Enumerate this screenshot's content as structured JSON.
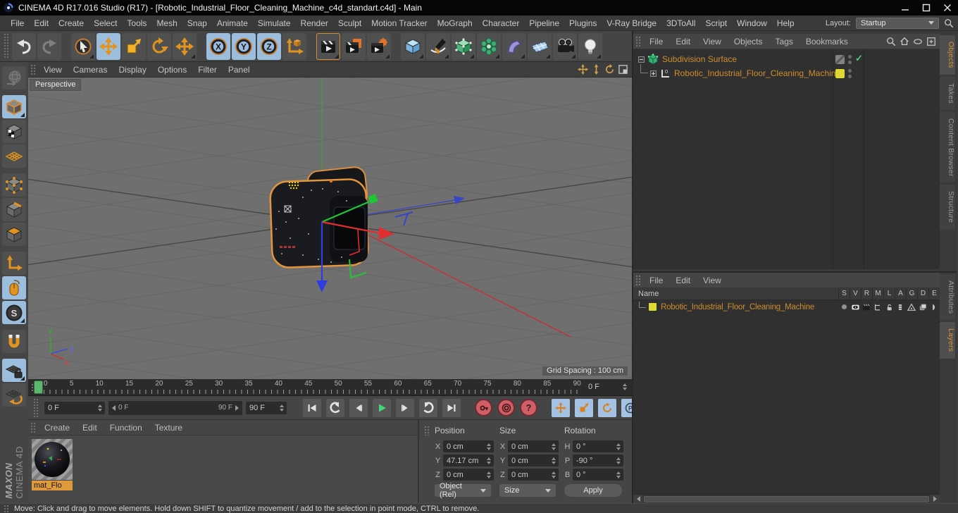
{
  "window": {
    "title": "CINEMA 4D R17.016 Studio (R17) - [Robotic_Industrial_Floor_Cleaning_Machine_c4d_standart.c4d] - Main"
  },
  "menu_bar": {
    "items": [
      "File",
      "Edit",
      "Create",
      "Select",
      "Tools",
      "Mesh",
      "Snap",
      "Animate",
      "Simulate",
      "Render",
      "Sculpt",
      "Motion Tracker",
      "MoGraph",
      "Character",
      "Pipeline",
      "Plugins",
      "V-Ray Bridge",
      "3DToAll",
      "Script",
      "Window",
      "Help"
    ],
    "layout_label": "Layout:",
    "layout_value": "Startup"
  },
  "toolbar": {
    "tools": [
      "undo",
      "redo",
      "live-selection",
      "move",
      "scale",
      "rotate",
      "last-tool-move",
      "axis-x",
      "axis-y",
      "axis-z",
      "coordinate-system",
      "render-view",
      "render-picture-viewer",
      "render-settings",
      "primitive-cube",
      "spline-pen",
      "subdivision-surface",
      "mograph",
      "deformer",
      "floor",
      "camera",
      "light"
    ],
    "axis_letters": {
      "x": "X",
      "y": "Y",
      "z": "Z"
    }
  },
  "palette": {
    "tools": [
      "make-editable",
      "model-mode",
      "texture-mode",
      "workplane-mode",
      "points-mode",
      "edges-mode",
      "polygons-mode",
      "axis-mode",
      "tweak-mode",
      "snap",
      "magnet-snap",
      "lock-workplane",
      "workplane-alignment"
    ],
    "snap_letter": "S"
  },
  "viewport": {
    "menu": [
      "View",
      "Cameras",
      "Display",
      "Options",
      "Filter",
      "Panel"
    ],
    "label": "Perspective",
    "grid_spacing": "Grid Spacing : 100 cm",
    "axis": {
      "x": "X",
      "y": "Y",
      "z": "Z"
    }
  },
  "timeline": {
    "ticks": [
      "0",
      "5",
      "10",
      "15",
      "20",
      "25",
      "30",
      "35",
      "40",
      "45",
      "50",
      "55",
      "60",
      "65",
      "70",
      "75",
      "80",
      "85",
      "90"
    ],
    "frame_field": "0 F"
  },
  "animation": {
    "start_field": "0 F",
    "range_start": "0 F",
    "range_end": "90 F",
    "end_field": "90 F",
    "p_letter": "P",
    "help_glyph": "?"
  },
  "material_manager": {
    "menu": [
      "Create",
      "Edit",
      "Function",
      "Texture"
    ],
    "materials": [
      {
        "name": "mat_Flo"
      }
    ]
  },
  "coordinates": {
    "groups": [
      {
        "title": "Position",
        "rows": [
          {
            "l": "X",
            "v": "0 cm"
          },
          {
            "l": "Y",
            "v": "47.17 cm"
          },
          {
            "l": "Z",
            "v": "0 cm"
          }
        ]
      },
      {
        "title": "Size",
        "rows": [
          {
            "l": "X",
            "v": "0 cm"
          },
          {
            "l": "Y",
            "v": "0 cm"
          },
          {
            "l": "Z",
            "v": "0 cm"
          }
        ]
      },
      {
        "title": "Rotation",
        "rows": [
          {
            "l": "H",
            "v": "0 °"
          },
          {
            "l": "P",
            "v": "-90 °"
          },
          {
            "l": "B",
            "v": "0 °"
          }
        ]
      }
    ],
    "mode_object": "Object (Rel)",
    "mode_size": "Size",
    "apply_label": "Apply"
  },
  "object_manager": {
    "menu": [
      "File",
      "Edit",
      "View",
      "Objects",
      "Tags",
      "Bookmarks"
    ],
    "items": [
      {
        "name": "Subdivision Surface",
        "enabled_glyph": "✓"
      },
      {
        "name": "Robotic_Industrial_Floor_Cleaning_Machine",
        "icon_badge": "0"
      }
    ]
  },
  "right_tabs_top": [
    {
      "label": "Objects",
      "active": true
    },
    {
      "label": "Takes"
    },
    {
      "label": "Content Browser"
    },
    {
      "label": "Structure"
    }
  ],
  "layer_manager": {
    "menu": [
      "File",
      "Edit",
      "View"
    ],
    "name_header": "Name",
    "columns": [
      "S",
      "V",
      "R",
      "M",
      "L",
      "A",
      "G",
      "D",
      "E"
    ],
    "rows": [
      {
        "name": "Robotic_Industrial_Floor_Cleaning_Machine"
      }
    ]
  },
  "right_tabs_bottom": [
    {
      "label": "Attributes"
    },
    {
      "label": "Layers",
      "active": true
    }
  ],
  "status_bar": {
    "text": "Move: Click and drag to move elements. Hold down SHIFT to quantize movement / add to the selection in point mode, CTRL to remove."
  },
  "brand": {
    "maxon": "MAXON",
    "cinema": "CINEMA 4D"
  },
  "colors": {
    "accent_orange": "#e09a3e",
    "active_blue": "#9cbede",
    "selection_green": "#5cb670",
    "panel_dark": "#303030",
    "viewport_gray": "#6f6f6f"
  }
}
